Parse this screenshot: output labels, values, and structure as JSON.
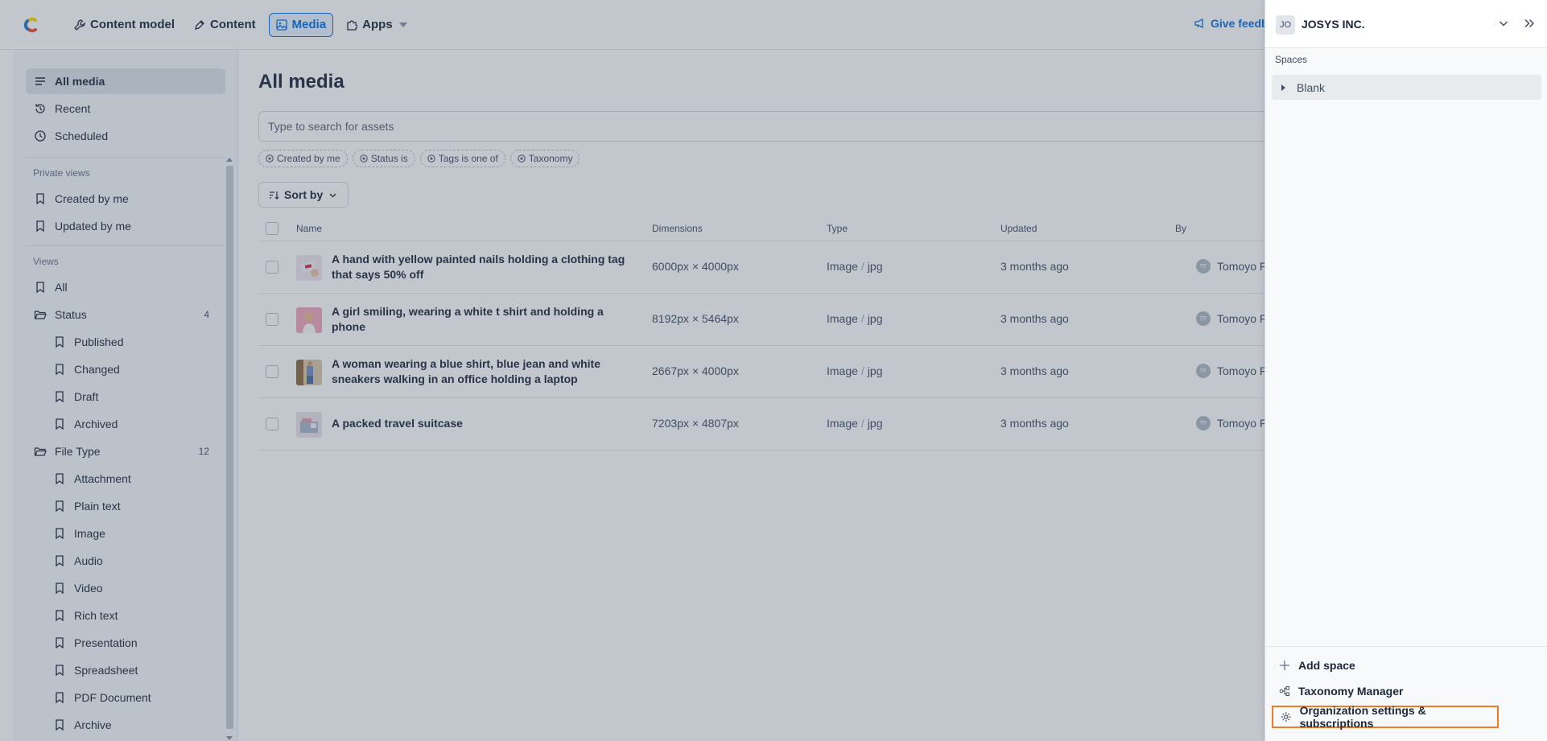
{
  "nav": {
    "items": [
      {
        "label": "Content model",
        "icon": "wrench-icon"
      },
      {
        "label": "Content",
        "icon": "pen-icon"
      },
      {
        "label": "Media",
        "icon": "image-icon",
        "active": true
      },
      {
        "label": "Apps",
        "icon": "puzzle-icon"
      }
    ],
    "feedback": "Give feedb"
  },
  "sidebar": {
    "top": [
      {
        "label": "All media",
        "icon": "list-icon",
        "active": true
      },
      {
        "label": "Recent",
        "icon": "history-icon"
      },
      {
        "label": "Scheduled",
        "icon": "clock-icon"
      }
    ],
    "private_heading": "Private views",
    "private": [
      {
        "label": "Created by me"
      },
      {
        "label": "Updated by me"
      }
    ],
    "views_heading": "Views",
    "views": {
      "all": "All",
      "status": {
        "label": "Status",
        "count": "4",
        "children": [
          "Published",
          "Changed",
          "Draft",
          "Archived"
        ]
      },
      "file_type": {
        "label": "File Type",
        "count": "12",
        "children": [
          "Attachment",
          "Plain text",
          "Image",
          "Audio",
          "Video",
          "Rich text",
          "Presentation",
          "Spreadsheet",
          "PDF Document",
          "Archive"
        ]
      }
    }
  },
  "main": {
    "title": "All media",
    "search_placeholder": "Type to search for assets",
    "filters": [
      "Created by me",
      "Status is",
      "Tags is one of",
      "Taxonomy"
    ],
    "sort_label": "Sort by",
    "columns": {
      "name": "Name",
      "dimensions": "Dimensions",
      "type": "Type",
      "updated": "Updated",
      "by": "By"
    },
    "rows": [
      {
        "name": "A hand with yellow painted nails holding a clothing tag that says 50% off",
        "dimensions": "6000px × 4000px",
        "type": "Image",
        "subtype": "jpg",
        "updated": "3 months ago",
        "avatar": "TF",
        "by": "Tomoyo Fujita"
      },
      {
        "name": "A girl smiling, wearing a white t shirt and holding a phone",
        "dimensions": "8192px × 5464px",
        "type": "Image",
        "subtype": "jpg",
        "updated": "3 months ago",
        "avatar": "TF",
        "by": "Tomoyo Fujita"
      },
      {
        "name": "A woman wearing a blue shirt, blue jean and white sneakers walking in an office holding a laptop",
        "dimensions": "2667px × 4000px",
        "type": "Image",
        "subtype": "jpg",
        "updated": "3 months ago",
        "avatar": "TF",
        "by": "Tomoyo Fujita"
      },
      {
        "name": "A packed travel suitcase",
        "dimensions": "7203px × 4807px",
        "type": "Image",
        "subtype": "jpg",
        "updated": "3 months ago",
        "avatar": "TF",
        "by": "Tomoyo Fujita"
      }
    ]
  },
  "panel": {
    "org_initials": "JO",
    "org_name": "JOSYS INC.",
    "spaces_label": "Spaces",
    "spaces": [
      "Blank"
    ],
    "actions": {
      "add_space": "Add space",
      "taxonomy": "Taxonomy Manager",
      "org_settings": "Organization settings & subscriptions"
    }
  },
  "colors": {
    "accent": "#036fe3",
    "highlight": "#f27a25",
    "sidebar_bg": "#f7f9fa"
  }
}
